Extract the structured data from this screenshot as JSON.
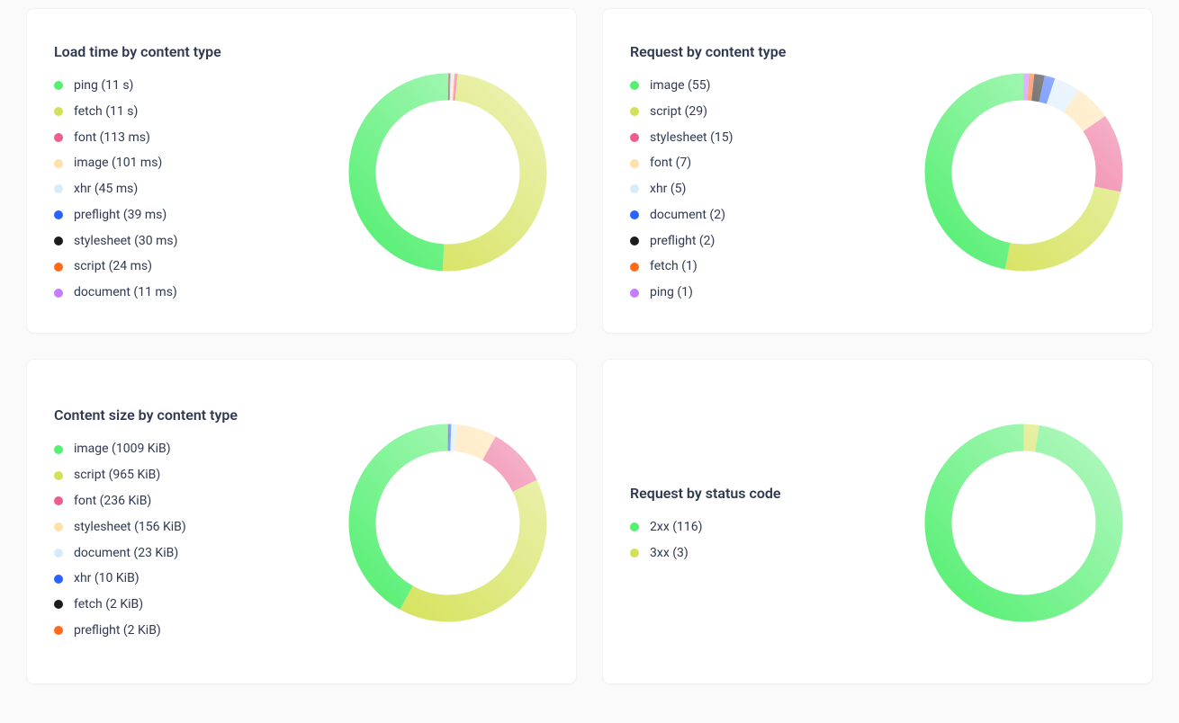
{
  "colors": {
    "green": "#55ef72",
    "olive": "#d4e157",
    "pink": "#ec5e8f",
    "cream": "#ffe0a6",
    "paleblue": "#d6ecfb",
    "blue": "#2962ff",
    "black": "#1c1c1c",
    "orange": "#ff6b1a",
    "purple": "#c77dff",
    "grey": "#a0a0a0"
  },
  "cards": [
    {
      "id": "load-time-by-content-type",
      "title": "Load time by content type",
      "items": [
        {
          "color": "green",
          "label": "ping (11 s)",
          "value": 11000
        },
        {
          "color": "olive",
          "label": "fetch (11 s)",
          "value": 11000
        },
        {
          "color": "pink",
          "label": "font (113 ms)",
          "value": 113
        },
        {
          "color": "cream",
          "label": "image (101 ms)",
          "value": 101
        },
        {
          "color": "paleblue",
          "label": "xhr (45 ms)",
          "value": 45
        },
        {
          "color": "blue",
          "label": "preflight (39 ms)",
          "value": 39
        },
        {
          "color": "black",
          "label": "stylesheet (30 ms)",
          "value": 30
        },
        {
          "color": "orange",
          "label": "script (24 ms)",
          "value": 24
        },
        {
          "color": "purple",
          "label": "document (11 ms)",
          "value": 11
        }
      ]
    },
    {
      "id": "request-by-content-type",
      "title": "Request by content type",
      "items": [
        {
          "color": "green",
          "label": "image (55)",
          "value": 55
        },
        {
          "color": "olive",
          "label": "script (29)",
          "value": 29
        },
        {
          "color": "pink",
          "label": "stylesheet (15)",
          "value": 15
        },
        {
          "color": "cream",
          "label": "font (7)",
          "value": 7
        },
        {
          "color": "paleblue",
          "label": "xhr (5)",
          "value": 5
        },
        {
          "color": "blue",
          "label": "document (2)",
          "value": 2
        },
        {
          "color": "black",
          "label": "preflight (2)",
          "value": 2
        },
        {
          "color": "orange",
          "label": "fetch (1)",
          "value": 1
        },
        {
          "color": "purple",
          "label": "ping (1)",
          "value": 1
        }
      ]
    },
    {
      "id": "content-size-by-content-type",
      "title": "Content size by content type",
      "items": [
        {
          "color": "green",
          "label": "image (1009 KiB)",
          "value": 1009
        },
        {
          "color": "olive",
          "label": "script (965 KiB)",
          "value": 965
        },
        {
          "color": "pink",
          "label": "font (236 KiB)",
          "value": 236
        },
        {
          "color": "cream",
          "label": "stylesheet (156 KiB)",
          "value": 156
        },
        {
          "color": "paleblue",
          "label": "document (23 KiB)",
          "value": 23
        },
        {
          "color": "blue",
          "label": "xhr (10 KiB)",
          "value": 10
        },
        {
          "color": "black",
          "label": "fetch (2 KiB)",
          "value": 2
        },
        {
          "color": "orange",
          "label": "preflight (2 KiB)",
          "value": 2
        }
      ]
    },
    {
      "id": "request-by-status-code",
      "title": "Request by status code",
      "items": [
        {
          "color": "green",
          "label": "2xx (116)",
          "value": 116
        },
        {
          "color": "olive",
          "label": "3xx (3)",
          "value": 3
        }
      ]
    }
  ],
  "chart_data": [
    {
      "type": "pie",
      "title": "Load time by content type",
      "series": [
        {
          "name": "ping",
          "values": [
            11000
          ],
          "unit": "ms"
        },
        {
          "name": "fetch",
          "values": [
            11000
          ],
          "unit": "ms"
        },
        {
          "name": "font",
          "values": [
            113
          ],
          "unit": "ms"
        },
        {
          "name": "image",
          "values": [
            101
          ],
          "unit": "ms"
        },
        {
          "name": "xhr",
          "values": [
            45
          ],
          "unit": "ms"
        },
        {
          "name": "preflight",
          "values": [
            39
          ],
          "unit": "ms"
        },
        {
          "name": "stylesheet",
          "values": [
            30
          ],
          "unit": "ms"
        },
        {
          "name": "script",
          "values": [
            24
          ],
          "unit": "ms"
        },
        {
          "name": "document",
          "values": [
            11
          ],
          "unit": "ms"
        }
      ]
    },
    {
      "type": "pie",
      "title": "Request by content type",
      "series": [
        {
          "name": "image",
          "values": [
            55
          ]
        },
        {
          "name": "script",
          "values": [
            29
          ]
        },
        {
          "name": "stylesheet",
          "values": [
            15
          ]
        },
        {
          "name": "font",
          "values": [
            7
          ]
        },
        {
          "name": "xhr",
          "values": [
            5
          ]
        },
        {
          "name": "document",
          "values": [
            2
          ]
        },
        {
          "name": "preflight",
          "values": [
            2
          ]
        },
        {
          "name": "fetch",
          "values": [
            1
          ]
        },
        {
          "name": "ping",
          "values": [
            1
          ]
        }
      ]
    },
    {
      "type": "pie",
      "title": "Content size by content type",
      "series": [
        {
          "name": "image",
          "values": [
            1009
          ],
          "unit": "KiB"
        },
        {
          "name": "script",
          "values": [
            965
          ],
          "unit": "KiB"
        },
        {
          "name": "font",
          "values": [
            236
          ],
          "unit": "KiB"
        },
        {
          "name": "stylesheet",
          "values": [
            156
          ],
          "unit": "KiB"
        },
        {
          "name": "document",
          "values": [
            23
          ],
          "unit": "KiB"
        },
        {
          "name": "xhr",
          "values": [
            10
          ],
          "unit": "KiB"
        },
        {
          "name": "fetch",
          "values": [
            2
          ],
          "unit": "KiB"
        },
        {
          "name": "preflight",
          "values": [
            2
          ],
          "unit": "KiB"
        }
      ]
    },
    {
      "type": "pie",
      "title": "Request by status code",
      "series": [
        {
          "name": "2xx",
          "values": [
            116
          ]
        },
        {
          "name": "3xx",
          "values": [
            3
          ]
        }
      ]
    }
  ]
}
